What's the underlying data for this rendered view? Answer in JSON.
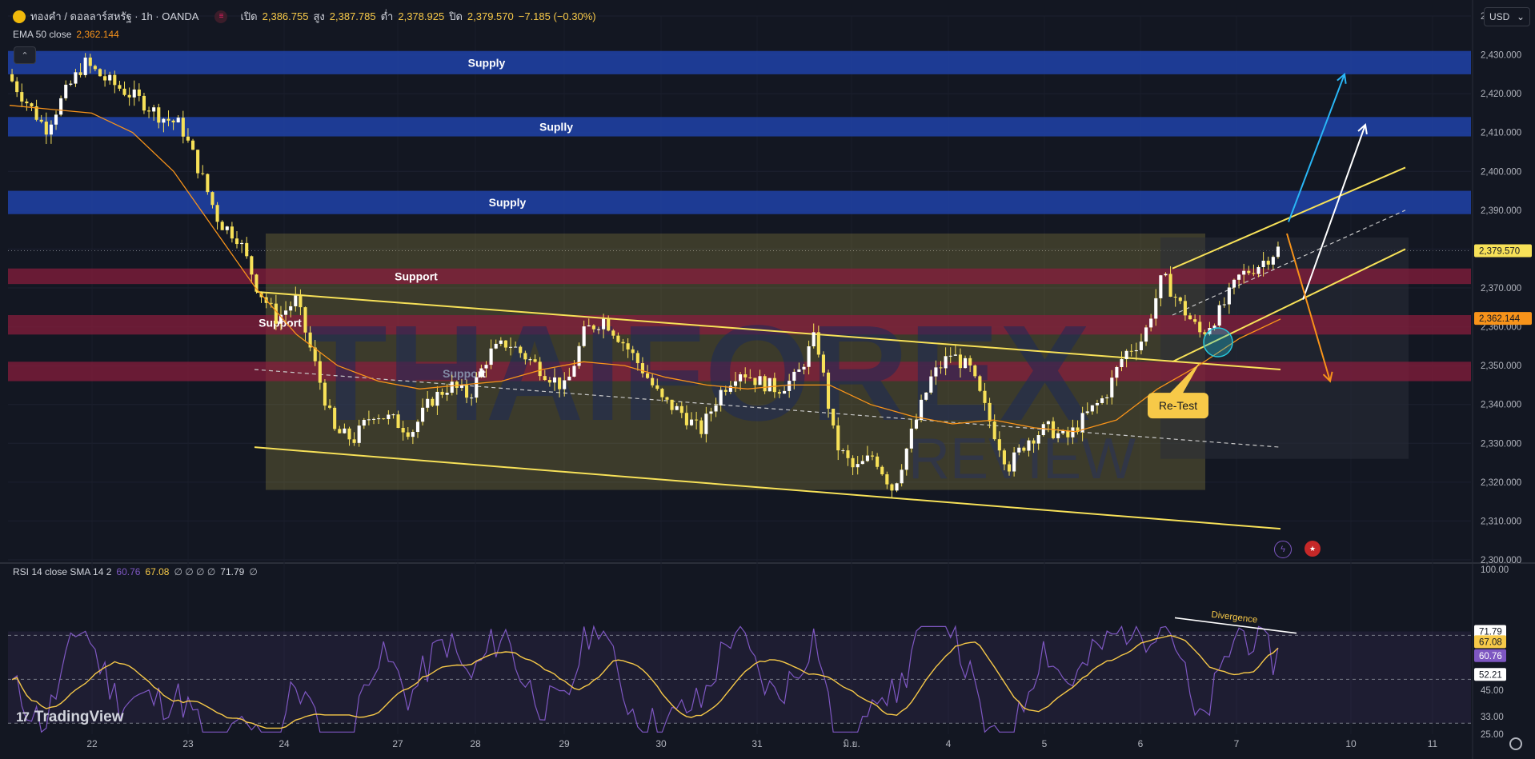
{
  "header": {
    "symbol": "ทองคำ / ดอลลาร์สหรัฐ · 1h · OANDA",
    "open_label": "เปิด",
    "open": "2,386.755",
    "high_label": "สูง",
    "high": "2,387.785",
    "low_label": "ต่ำ",
    "low": "2,378.925",
    "close_label": "ปิด",
    "close": "2,379.570",
    "change": "−7.185 (−0.30%)"
  },
  "ema": {
    "label": "EMA 50 close",
    "value": "2,362.144"
  },
  "rsi": {
    "label": "RSI 14 close SMA 14 2",
    "v1": "60.76",
    "v2": "67.08",
    "rest": "∅ ∅ ∅ ∅",
    "v3": "71.79",
    "last": "∅"
  },
  "currency": "USD",
  "brand": "TradingView",
  "watermark": {
    "line1": "THAIFOREX",
    "line2": "REVIEW"
  },
  "zones": {
    "supply": [
      {
        "label": "Supply",
        "from": 2425,
        "to": 2431
      },
      {
        "label": "Suplly",
        "from": 2409,
        "to": 2414
      },
      {
        "label": "Supply",
        "from": 2389,
        "to": 2395
      }
    ],
    "support": [
      {
        "label": "Support",
        "from": 2371,
        "to": 2375
      },
      {
        "label": "Support",
        "from": 2358,
        "to": 2363
      },
      {
        "label": "Support",
        "from": 2346,
        "to": 2351
      }
    ]
  },
  "annotations": {
    "retest": "Re-Test",
    "divergence": "Divergence"
  },
  "colors": {
    "bg": "#131722",
    "supply": "#1e3f9e",
    "support": "#8b1d3d",
    "candle": "#f7e158",
    "ema": "#f7931a",
    "channel": "#f7e158",
    "rsi": "#7e57c2",
    "rsi_ma": "#f7c948",
    "arrow_up": "#29b6f6",
    "arrow_down": "#f7931a"
  },
  "chart_data": {
    "type": "candlestick",
    "y_axis_ticks": [
      "2,440.000",
      "2,430.000",
      "2,420.000",
      "2,410.000",
      "2,400.000",
      "2,390.000",
      "2,380.000",
      "2,370.000",
      "2,360.000",
      "2,350.000",
      "2,340.000",
      "2,330.000",
      "2,320.000",
      "2,310.000",
      "2,300.000"
    ],
    "ylim": [
      2300,
      2440
    ],
    "x_axis_ticks": [
      "22",
      "23",
      "24",
      "27",
      "28",
      "29",
      "30",
      "31",
      "มิ.ย.",
      "4",
      "5",
      "6",
      "7",
      "10",
      "11"
    ],
    "price_labels": {
      "last": "2,379.570",
      "ema": "2,362.144"
    },
    "close_path": [
      2425,
      2418,
      2411,
      2420,
      2428,
      2424,
      2421,
      2418,
      2414,
      2412,
      2400,
      2387,
      2383,
      2370,
      2362,
      2367,
      2350,
      2333,
      2331,
      2338,
      2336,
      2333,
      2341,
      2345,
      2342,
      2353,
      2356,
      2352,
      2348,
      2344,
      2359,
      2362,
      2356,
      2349,
      2341,
      2338,
      2333,
      2343,
      2349,
      2346,
      2344,
      2347,
      2358,
      2330,
      2323,
      2327,
      2318,
      2333,
      2347,
      2353,
      2349,
      2336,
      2324,
      2331,
      2334,
      2331,
      2337,
      2342,
      2353,
      2357,
      2373,
      2365,
      2358,
      2364,
      2373,
      2376,
      2380
    ],
    "ema50_path": [
      2417,
      2416,
      2415,
      2410,
      2400,
      2385,
      2370,
      2358,
      2350,
      2346,
      2344,
      2345,
      2346,
      2349,
      2351,
      2350,
      2347,
      2345,
      2344,
      2345,
      2345,
      2340,
      2337,
      2335,
      2336,
      2334,
      2333,
      2336,
      2344,
      2350,
      2357,
      2362
    ],
    "rsi": {
      "ticks": [
        "100.00",
        "71.79",
        "67.08",
        "60.76",
        "52.21",
        "45.00",
        "33.00",
        "25.00"
      ],
      "ylim": [
        25,
        100
      ],
      "levels": [
        70,
        50,
        30
      ],
      "last": {
        "rsi": 60.76,
        "ma": 67.08,
        "upper": 71.79,
        "lower": 52.21
      }
    }
  }
}
